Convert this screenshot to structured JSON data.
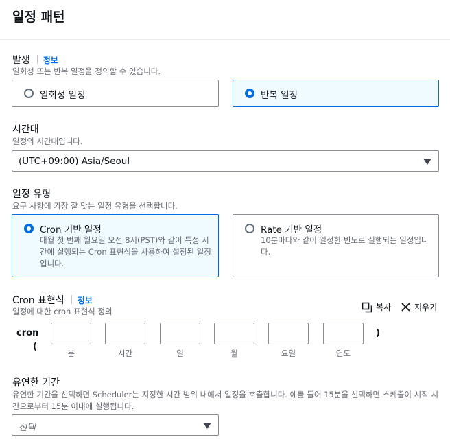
{
  "header": {
    "title": "일정 패턴"
  },
  "occurrence": {
    "label": "발생",
    "info": "정보",
    "description": "일회성 또는 반복 일정을 정의할 수 있습니다.",
    "options": [
      {
        "label": "일회성 일정",
        "selected": false
      },
      {
        "label": "반복 일정",
        "selected": true
      }
    ]
  },
  "timezone": {
    "label": "시간대",
    "description": "일정의 시간대입니다.",
    "value": "(UTC+09:00) Asia/Seoul"
  },
  "schedule_type": {
    "label": "일정 유형",
    "description": "요구 사항에 가장 잘 맞는 일정 유형을 선택합니다.",
    "options": [
      {
        "label": "Cron 기반 일정",
        "description": "매월 첫 번째 월요일 오전 8시(PST)와 같이 특정 시간에 실행되는 Cron 표현식을 사용하여 설정된 일정입니다.",
        "selected": true
      },
      {
        "label": "Rate 기반 일정",
        "description": "10분마다와 같이 일정한 빈도로 실행되는 일정입니다.",
        "selected": false
      }
    ]
  },
  "cron": {
    "label": "Cron 표현식",
    "info": "정보",
    "description": "일정에 대한 cron 표현식 정의",
    "copy_label": "복사",
    "clear_label": "지우기",
    "prefix": "cron",
    "open_paren": "(",
    "close_paren": ")",
    "fields": [
      {
        "caption": "분",
        "value": ""
      },
      {
        "caption": "시간",
        "value": ""
      },
      {
        "caption": "일",
        "value": ""
      },
      {
        "caption": "월",
        "value": ""
      },
      {
        "caption": "요일",
        "value": ""
      },
      {
        "caption": "연도",
        "value": ""
      }
    ]
  },
  "flexible_window": {
    "label": "유연한 기간",
    "description": "유연한 기간을 선택하면 Scheduler는 지정한 시간 범위 내에서 일정을 호출합니다. 예를 들어 15분을 선택하면 스케줄이 시작 시간으로부터 15분 이내에 실행됩니다.",
    "placeholder": "선택"
  },
  "colors": {
    "accent": "#006ce0",
    "selected_bg": "#f0fbff",
    "border": "#8c8c94",
    "secondary_text": "#656871"
  }
}
